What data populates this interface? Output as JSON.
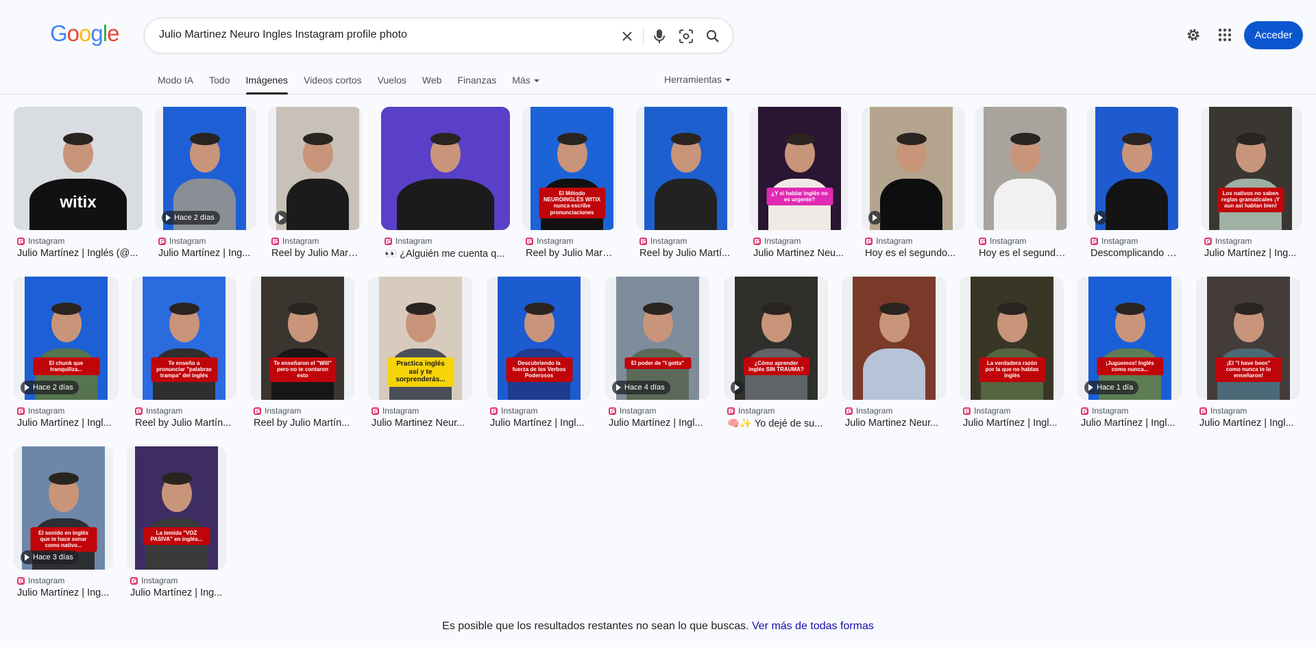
{
  "search": {
    "query": "Julio Martinez Neuro Ingles Instagram profile photo"
  },
  "header": {
    "logo": [
      "G",
      "o",
      "o",
      "g",
      "l",
      "e"
    ],
    "logo_colors": [
      "#4285f4",
      "#ea4335",
      "#fbbc05",
      "#4285f4",
      "#34a853",
      "#ea4335"
    ],
    "signin_label": "Acceder",
    "settings_icon": "gear-icon",
    "apps_icon": "grid-apps-icon"
  },
  "tabs": {
    "items": [
      {
        "label": "Modo IA"
      },
      {
        "label": "Todo"
      },
      {
        "label": "Imágenes",
        "active": true
      },
      {
        "label": "Videos cortos"
      },
      {
        "label": "Vuelos"
      },
      {
        "label": "Web"
      },
      {
        "label": "Finanzas"
      },
      {
        "label": "Más"
      }
    ],
    "tools_label": "Herramientas"
  },
  "results": [
    {
      "source": "Instagram",
      "title": "Julio Martínez | Inglés (@...",
      "bg": "#d9dde2",
      "shirt": "#111111",
      "badge": "",
      "caption": "witix"
    },
    {
      "source": "Instagram",
      "title": "Julio Martínez | Ing...",
      "bg": "#1f5fd6",
      "shirt": "#8a8f96",
      "badge": "Hace 2 días",
      "caption": ""
    },
    {
      "source": "Instagram",
      "title": "Reel by Julio Martí...",
      "bg": "#c8c1b8",
      "shirt": "#1b1b1b",
      "badge": "play",
      "caption": ""
    },
    {
      "source": "Instagram",
      "title": "👀 ¿Alguién me cuenta q...",
      "bg": "#5a3fc8",
      "shirt": "#1b1b1b",
      "badge": "",
      "caption": ""
    },
    {
      "source": "Instagram",
      "title": "Reel by Julio Martí...",
      "bg": "#1d63d8",
      "shirt": "#111111",
      "badge": "",
      "caption": "El Método NEUROINGLÉS WITIX nunca escribe pronunciaciones"
    },
    {
      "source": "Instagram",
      "title": "Reel by Julio Martí...",
      "bg": "#1d5fcf",
      "shirt": "#222222",
      "badge": "",
      "caption": ""
    },
    {
      "source": "Instagram",
      "title": "Julio Martinez Neu...",
      "bg": "#2a1533",
      "shirt": "#efeae5",
      "badge": "",
      "caption": "¿Y si hablar inglés no es urgente?",
      "caption_style": "pink"
    },
    {
      "source": "Instagram",
      "title": "Hoy es el segundo...",
      "bg": "#b5a48e",
      "shirt": "#0e0e0e",
      "badge": "play",
      "caption": ""
    },
    {
      "source": "Instagram",
      "title": "Hoy es el segundo...",
      "bg": "#a9a39d",
      "shirt": "#f1f1f1",
      "badge": "",
      "caption": ""
    },
    {
      "source": "Instagram",
      "title": "Descomplicando el...",
      "bg": "#1e5bd0",
      "shirt": "#141414",
      "badge": "play",
      "caption": ""
    },
    {
      "source": "Instagram",
      "title": "Julio Martínez | Ing...",
      "bg": "#3a3632",
      "shirt": "#9fb0a5",
      "badge": "",
      "caption": "Los nativos no saben reglas gramaticales ¡Y aun así hablan bien!"
    },
    {
      "source": "Instagram",
      "title": "Julio Martínez | Ingl...",
      "bg": "#1d5fd4",
      "shirt": "#56744f",
      "badge": "Hace 2 días",
      "caption": "El chunk que tranquiliza..."
    },
    {
      "source": "Instagram",
      "title": "Reel by Julio Martín...",
      "bg": "#2a6be0",
      "shirt": "#2e2e2e",
      "badge": "",
      "caption": "Te enseño a pronunciar \"palabras trampa\" del inglés"
    },
    {
      "source": "Instagram",
      "title": "Reel by Julio Martín...",
      "bg": "#3b3530",
      "shirt": "#171717",
      "badge": "",
      "caption": "Te enseñaron el \"Will\" pero no te contaron esto"
    },
    {
      "source": "Instagram",
      "title": "Julio Martinez Neur...",
      "bg": "#d7cbbd",
      "shirt": "#4a4f57",
      "badge": "",
      "caption": "Practica inglés así y te sorprenderás...",
      "caption_style": "yellow"
    },
    {
      "source": "Instagram",
      "title": "Julio Martínez | Ingl...",
      "bg": "#1c5bd0",
      "shirt": "#1e3b8f",
      "badge": "",
      "caption": "Descubriendo la fuerza de los Verbos Poderosos"
    },
    {
      "source": "Instagram",
      "title": "Julio Martínez | Ingl...",
      "bg": "#7e8c9c",
      "shirt": "#5b6a58",
      "badge": "Hace 4 días",
      "caption": "El poder de \"I gotta\""
    },
    {
      "source": "Instagram",
      "title": "🧠✨ Yo dejé de su...",
      "bg": "#2f2f2c",
      "shirt": "#5f6468",
      "badge": "play",
      "caption": "¿Cómo aprender inglés SIN TRAUMA?"
    },
    {
      "source": "Instagram",
      "title": "Julio Martinez Neur...",
      "bg": "#7a3a2a",
      "shirt": "#b7c3d8",
      "badge": "",
      "caption": ""
    },
    {
      "source": "Instagram",
      "title": "Julio Martínez | Ingl...",
      "bg": "#3a3626",
      "shirt": "#556542",
      "badge": "",
      "caption": "La verdadera razón por la que no hablas inglés"
    },
    {
      "source": "Instagram",
      "title": "Julio Martínez | Ingl...",
      "bg": "#1a5fd6",
      "shirt": "#5e7d55",
      "badge": "Hace 1 día",
      "caption": "¡Juguemos! Inglés como nunca..."
    },
    {
      "source": "Instagram",
      "title": "Julio Martínez | Ingl...",
      "bg": "#433c3a",
      "shirt": "#4b6a77",
      "badge": "",
      "caption": "¡El \"I have been\" como nunca te lo enseñaron!"
    },
    {
      "source": "Instagram",
      "title": "Julio Martínez | Ing...",
      "bg": "#6e87a8",
      "shirt": "#2e2f33",
      "badge": "Hace 3 días",
      "caption": "El sonido en inglés que te hace sonar como nativo..."
    },
    {
      "source": "Instagram",
      "title": "Julio Martínez | Ing...",
      "bg": "#3d2d62",
      "shirt": "#3a3a3a",
      "badge": "",
      "caption": "La temida \"VOZ PASIVA\" en inglés..."
    }
  ],
  "footer": {
    "text": "Es posible que los resultados restantes no sean lo que buscas.",
    "link": "Ver más de todas formas"
  }
}
